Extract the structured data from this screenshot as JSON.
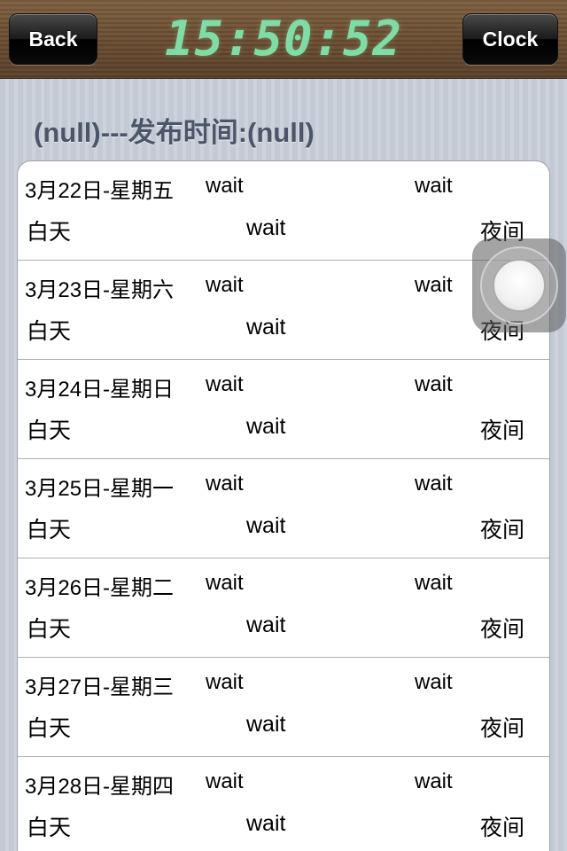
{
  "navbar": {
    "back_label": "Back",
    "clock_label": "Clock",
    "time": "15:50:52"
  },
  "header": {
    "title": "(null)---发布时间:(null)"
  },
  "forecast": [
    {
      "date": "3月22日-星期五",
      "wait_a": "wait",
      "wait_b": "wait",
      "day_label": "白天",
      "wait_c": "wait",
      "night_label": "夜间"
    },
    {
      "date": "3月23日-星期六",
      "wait_a": "wait",
      "wait_b": "wait",
      "day_label": "白天",
      "wait_c": "wait",
      "night_label": "夜间"
    },
    {
      "date": "3月24日-星期日",
      "wait_a": "wait",
      "wait_b": "wait",
      "day_label": "白天",
      "wait_c": "wait",
      "night_label": "夜间"
    },
    {
      "date": "3月25日-星期一",
      "wait_a": "wait",
      "wait_b": "wait",
      "day_label": "白天",
      "wait_c": "wait",
      "night_label": "夜间"
    },
    {
      "date": "3月26日-星期二",
      "wait_a": "wait",
      "wait_b": "wait",
      "day_label": "白天",
      "wait_c": "wait",
      "night_label": "夜间"
    },
    {
      "date": "3月27日-星期三",
      "wait_a": "wait",
      "wait_b": "wait",
      "day_label": "白天",
      "wait_c": "wait",
      "night_label": "夜间"
    },
    {
      "date": "3月28日-星期四",
      "wait_a": "wait",
      "wait_b": "wait",
      "day_label": "白天",
      "wait_c": "wait",
      "night_label": "夜间"
    }
  ],
  "colors": {
    "clock_digits": "#7fdca4",
    "title_text": "#4c566a",
    "navbar_wood": "#6b4e33"
  },
  "icons": {
    "assistive_touch": "assistive-touch-icon"
  }
}
